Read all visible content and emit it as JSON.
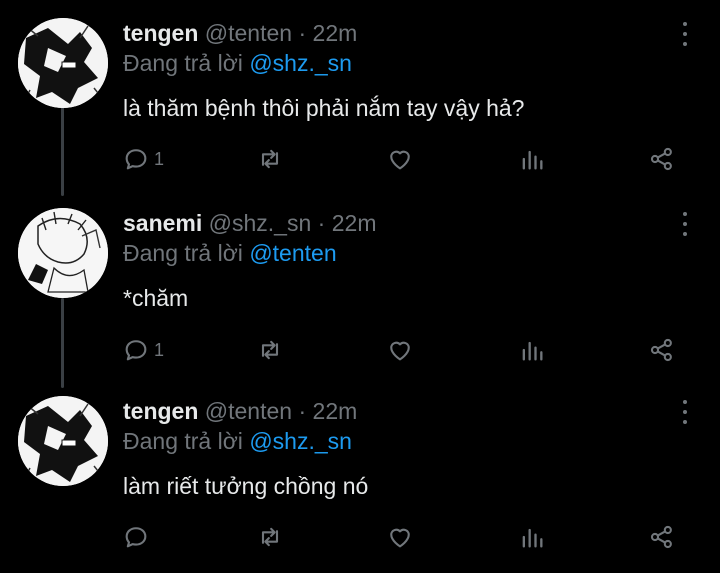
{
  "colors": {
    "background": "#000000",
    "text": "#e7e9ea",
    "muted": "#71767b",
    "link": "#1d9bf0",
    "thread_line": "#3a3f44"
  },
  "tweets": [
    {
      "name": "tengen",
      "handle": "@tenten",
      "sep": "·",
      "time": "22m",
      "reply_prefix": "Đang trả lời",
      "reply_to": "@shz._sn",
      "text": "là thăm bệnh thôi phải nắm tay vậy hả?",
      "reply_count": "1",
      "icons": [
        "reply-icon",
        "retweet-icon",
        "like-icon",
        "analytics-icon",
        "share-icon",
        "more-icon"
      ]
    },
    {
      "name": "sanemi",
      "handle": "@shz._sn",
      "sep": "·",
      "time": "22m",
      "reply_prefix": "Đang trả lời",
      "reply_to": "@tenten",
      "text": "*chăm",
      "reply_count": "1",
      "icons": [
        "reply-icon",
        "retweet-icon",
        "like-icon",
        "analytics-icon",
        "share-icon",
        "more-icon"
      ]
    },
    {
      "name": "tengen",
      "handle": "@tenten",
      "sep": "·",
      "time": "22m",
      "reply_prefix": "Đang trả lời",
      "reply_to": "@shz._sn",
      "text": "làm riết tưởng chồng nó",
      "reply_count": "",
      "icons": [
        "reply-icon",
        "retweet-icon",
        "like-icon",
        "analytics-icon",
        "share-icon",
        "more-icon"
      ]
    }
  ]
}
